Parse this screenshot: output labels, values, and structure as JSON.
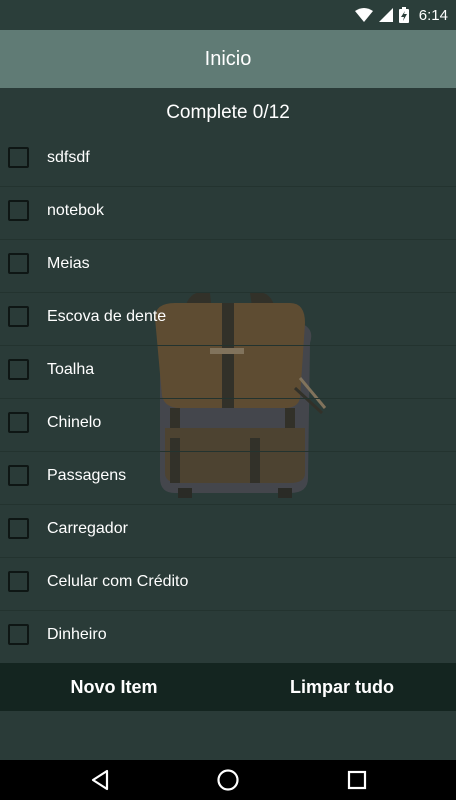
{
  "status_bar": {
    "time": "6:14",
    "icons": [
      "wifi-icon",
      "cell-signal-icon",
      "battery-charging-icon"
    ]
  },
  "app_bar": {
    "title": "Inicio",
    "color": "#607b75"
  },
  "checklist": {
    "header": "Complete 0/12",
    "items": [
      {
        "label": "sdfsdf",
        "checked": false
      },
      {
        "label": "notebok",
        "checked": false
      },
      {
        "label": "Meias",
        "checked": false
      },
      {
        "label": "Escova de dente",
        "checked": false
      },
      {
        "label": "Toalha",
        "checked": false
      },
      {
        "label": "Chinelo",
        "checked": false
      },
      {
        "label": "Passagens",
        "checked": false
      },
      {
        "label": "Carregador",
        "checked": false
      },
      {
        "label": "Celular com Crédito",
        "checked": false
      },
      {
        "label": "Dinheiro",
        "checked": false
      }
    ],
    "background_image": "backpack-illustration"
  },
  "actions": {
    "new_item": "Novo Item",
    "clear_all": "Limpar tudo"
  },
  "nav_bar": {
    "buttons": [
      "back-icon",
      "home-icon",
      "recents-icon"
    ]
  },
  "colors": {
    "background": "#2a3b38",
    "action_bar": "#142520",
    "text": "#ffffff"
  }
}
